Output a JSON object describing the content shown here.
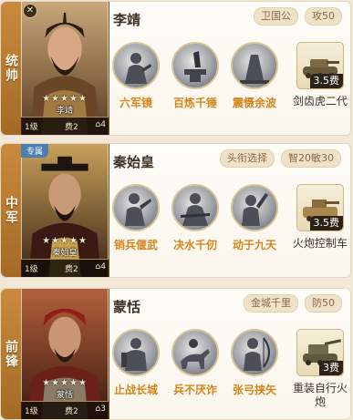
{
  "cards": [
    {
      "role": "统帅",
      "hero": "李靖",
      "caption": "李靖",
      "stars": "★★★★★",
      "level": "1级",
      "cost": "费2",
      "move": "⌂4",
      "badge": "✕",
      "tags": [
        "卫国公",
        "攻50"
      ],
      "skills": [
        "六军镜",
        "百炼千锤",
        "震慑余波"
      ],
      "equip": {
        "cost": "3.5费",
        "name": "剑齿虎二代"
      }
    },
    {
      "role": "中军",
      "special": "专属",
      "hero": "秦始皇",
      "caption": "秦始皇",
      "stars": "★★★★★",
      "level": "1级",
      "cost": "费2",
      "move": "⌂4",
      "tags": [
        "头衔选择",
        "智20敏30"
      ],
      "skills": [
        "销兵偃武",
        "决水千仞",
        "动于九天"
      ],
      "equip": {
        "cost": "3.5费",
        "name": "火炮控制车"
      }
    },
    {
      "role": "前锋",
      "hero": "蒙恬",
      "caption": "蒙恬",
      "stars": "★★★★★",
      "level": "1级",
      "cost": "费2",
      "move": "⌂3",
      "tags": [
        "金城千里",
        "防50"
      ],
      "skills": [
        "止战长城",
        "兵不厌诈",
        "张弓挟矢"
      ],
      "equip": {
        "cost": "3费",
        "name": "重装自行火炮"
      }
    }
  ],
  "colors": {
    "skill_label": "#d4861d",
    "role_strip": "#b87a30",
    "special_tag": "#4d7fb3"
  },
  "icons": {
    "skills": [
      "strategist-icon",
      "anvil-icon",
      "monument-icon",
      "kneeling-figure-icon",
      "warrior-icon",
      "pointing-figure-icon",
      "armored-soldier-icon",
      "horse-rider-icon",
      "archer-icon"
    ],
    "equipment": [
      "tank-icon",
      "artillery-car-icon",
      "self-propelled-gun-icon"
    ]
  }
}
